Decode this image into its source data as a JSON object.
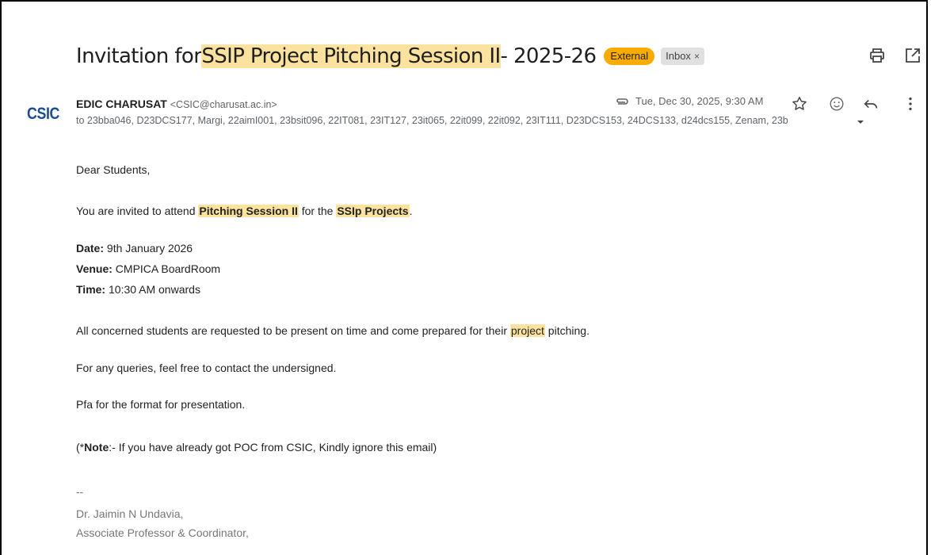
{
  "subject": {
    "before": "Invitation for ",
    "highlight": "SSIP Project Pitching Session II",
    "after": " - 2025-26"
  },
  "labels": {
    "external": "External",
    "inbox": "Inbox",
    "inbox_remove": "×"
  },
  "sender": {
    "logo_text": "CSIC",
    "name": "EDIC CHARUSAT",
    "email": "<CSIC@charusat.ac.in>",
    "recipients": "to 23bba046, D23DCS177, Margi, 22aimI001, 23bsit096, 22IT081, 23IT127, 23it065, 22it099, 22it092, 23IT111, D23DCS153, 24DCS133, d24dcs155, Zenam, 23b"
  },
  "meta": {
    "date": "Tue, Dec 30, 2025, 9:30 AM"
  },
  "body": {
    "greeting": "Dear Students,",
    "invite": {
      "p1": "You are invited to attend ",
      "h1": "Pitching Session II",
      "p2": " for the ",
      "h2": "SSIp Projects",
      "p3": "."
    },
    "date_label": "Date:",
    "date_value": " 9th January 2026",
    "venue_label": "Venue:",
    "venue_value": " CMPICA BoardRoom",
    "time_label": "Time:",
    "time_value": " 10:30 AM onwards",
    "line_present": {
      "before": "All concerned students are requested to be present on time and come prepared for their ",
      "highlight": "project",
      "after": " pitching."
    },
    "queries": "For any queries, feel free to contact the undersigned.",
    "pfa": "Pfa for the format for presentation.",
    "note": {
      "open": "(*",
      "label": "Note",
      "text": ":- If you have already got POC from CSIC, Kindly ignore this email)"
    },
    "signature": {
      "dashes": "--",
      "name": "Dr. Jaimin N Undavia,",
      "title": "Associate Professor & Coordinator,"
    }
  },
  "icons": {
    "print": "print-icon",
    "open_new": "open-in-new-window-icon",
    "attachment": "paperclip-icon",
    "star": "star-icon",
    "emoji": "emoji-reaction-icon",
    "reply": "reply-icon",
    "more": "more-vert-icon",
    "expand": "chevron-down-icon"
  },
  "colors": {
    "highlight": "#fbe29f",
    "external_badge": "#f9ab00",
    "inbox_badge": "#e0e0e0",
    "logo": "#1a4d97"
  }
}
